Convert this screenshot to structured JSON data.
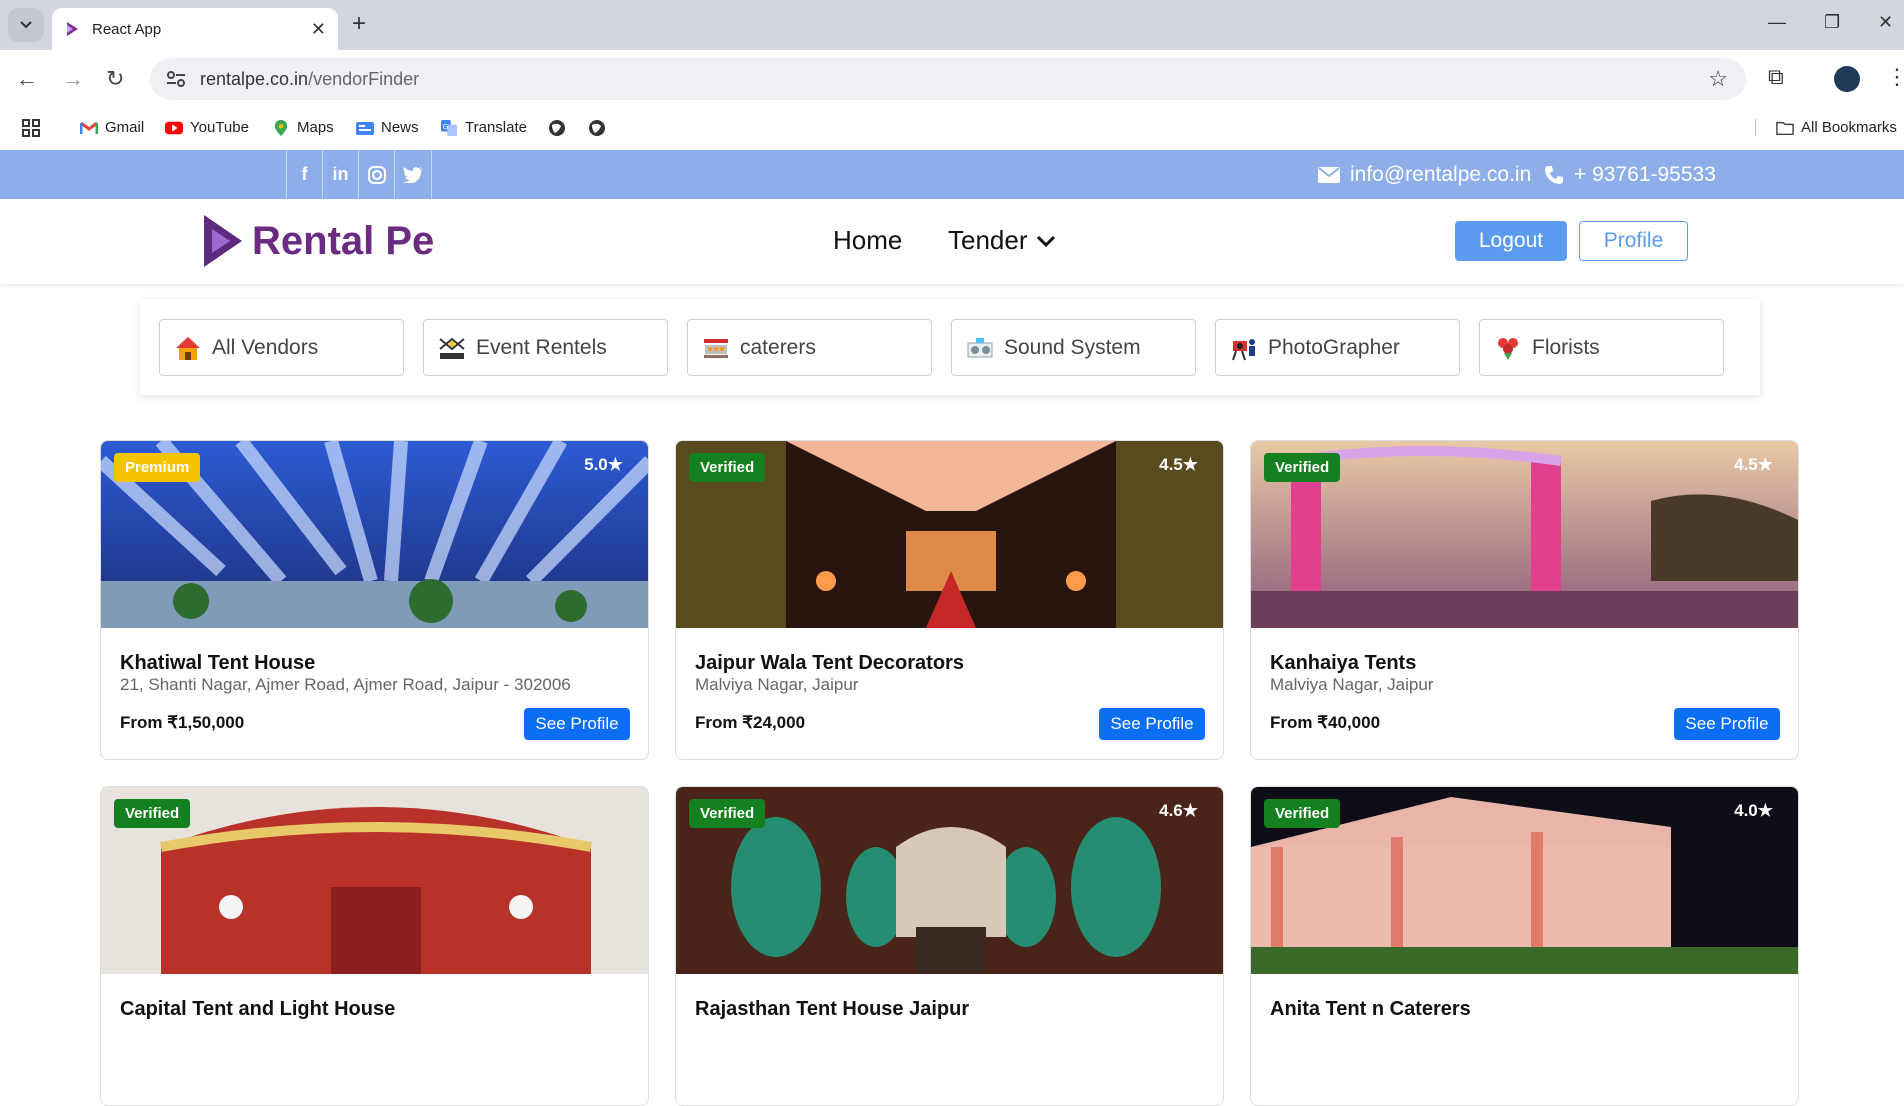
{
  "browser": {
    "tab_title": "React App",
    "url_host": "rentalpe.co.in",
    "url_path": "/vendorFinder",
    "bookmarks": [
      "Gmail",
      "YouTube",
      "Maps",
      "News",
      "Translate"
    ],
    "all_bookmarks": "All Bookmarks"
  },
  "topbar": {
    "email": "info@rentalpe.co.in",
    "phone": "+ 93761-95533",
    "social_icons": [
      "facebook-icon",
      "linkedin-icon",
      "instagram-icon",
      "twitter-icon"
    ],
    "bg_color": "#8eaeea"
  },
  "header": {
    "brand": "Rental Pe",
    "nav": {
      "home": "Home",
      "tender": "Tender"
    },
    "logout": "Logout",
    "profile": "Profile"
  },
  "categories": [
    "All Vendors",
    "Event Rentels",
    "caterers",
    "Sound System",
    "PhotoGrapher",
    "Florists"
  ],
  "vendors": [
    {
      "badge": "Premium",
      "rating": "5.0★",
      "name": "Khatiwal Tent House",
      "address": "21, Shanti Nagar, Ajmer Road, Ajmer Road, Jaipur - 302006",
      "price": "From ₹1,50,000",
      "cta": "See Profile"
    },
    {
      "badge": "Verified",
      "rating": "4.5★",
      "name": "Jaipur Wala Tent Decorators",
      "address": "Malviya Nagar, Jaipur",
      "price": "From ₹24,000",
      "cta": "See Profile"
    },
    {
      "badge": "Verified",
      "rating": "4.5★",
      "name": "Kanhaiya Tents",
      "address": "Malviya Nagar, Jaipur",
      "price": "From ₹40,000",
      "cta": "See Profile"
    },
    {
      "badge": "Verified",
      "rating": "",
      "name": "Capital Tent and Light House",
      "address": "",
      "price": "",
      "cta": ""
    },
    {
      "badge": "Verified",
      "rating": "4.6★",
      "name": "Rajasthan Tent House Jaipur",
      "address": "",
      "price": "",
      "cta": ""
    },
    {
      "badge": "Verified",
      "rating": "4.0★",
      "name": "Anita Tent n Caterers",
      "address": "",
      "price": "",
      "cta": ""
    }
  ],
  "colors": {
    "premium": "#f5c400",
    "verified": "#14801f",
    "primary": "#0b6ef5",
    "brand": "#6b2b80"
  }
}
